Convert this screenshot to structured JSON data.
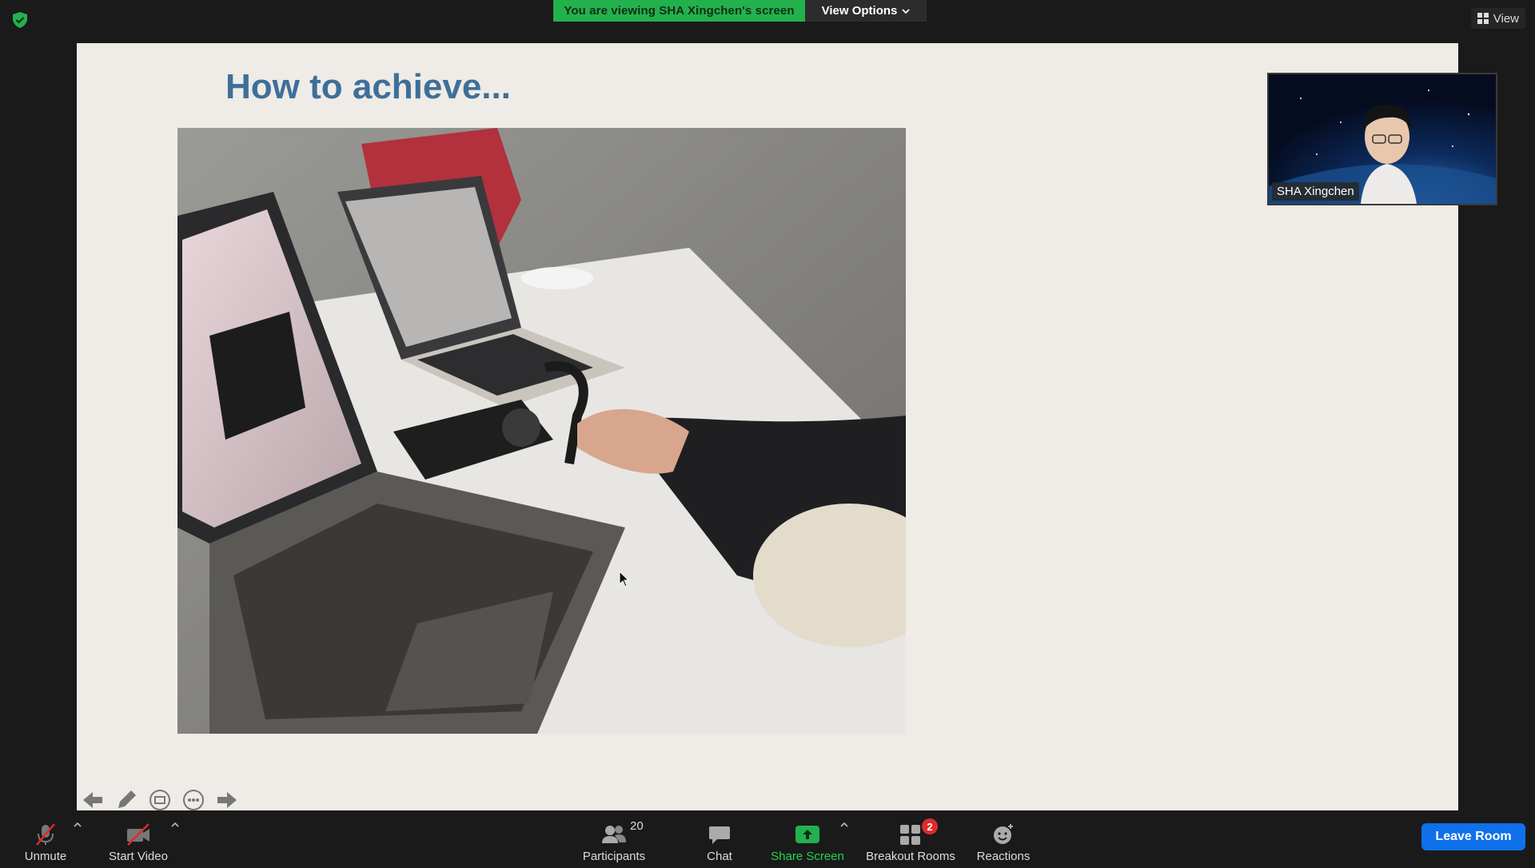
{
  "banner": {
    "viewing_text": "You are viewing SHA Xingchen's screen",
    "view_options_label": "View Options",
    "view_label": "View"
  },
  "slide": {
    "title": "How to achieve..."
  },
  "participant": {
    "name": "SHA Xingchen"
  },
  "toolbar": {
    "unmute_label": "Unmute",
    "start_video_label": "Start Video",
    "participants_label": "Participants",
    "participants_count": "20",
    "chat_label": "Chat",
    "share_screen_label": "Share Screen",
    "breakout_rooms_label": "Breakout Rooms",
    "breakout_badge": "2",
    "reactions_label": "Reactions",
    "leave_label": "Leave Room"
  },
  "colors": {
    "banner_green": "#23b14d",
    "share_green": "#23d44f",
    "leave_blue": "#0e71eb",
    "badge_red": "#e02a2a",
    "slide_title_blue": "#3e6f9a"
  },
  "icons": [
    "shield-icon",
    "chevron-down-icon",
    "grid-view-icon",
    "muted-mic-icon",
    "video-off-icon",
    "participants-icon",
    "chat-bubble-icon",
    "share-screen-icon",
    "breakout-rooms-icon",
    "reactions-icon",
    "arrow-left-icon",
    "pencil-icon",
    "spotlight-icon",
    "more-icon",
    "arrow-right-icon",
    "mouse-cursor-icon"
  ]
}
